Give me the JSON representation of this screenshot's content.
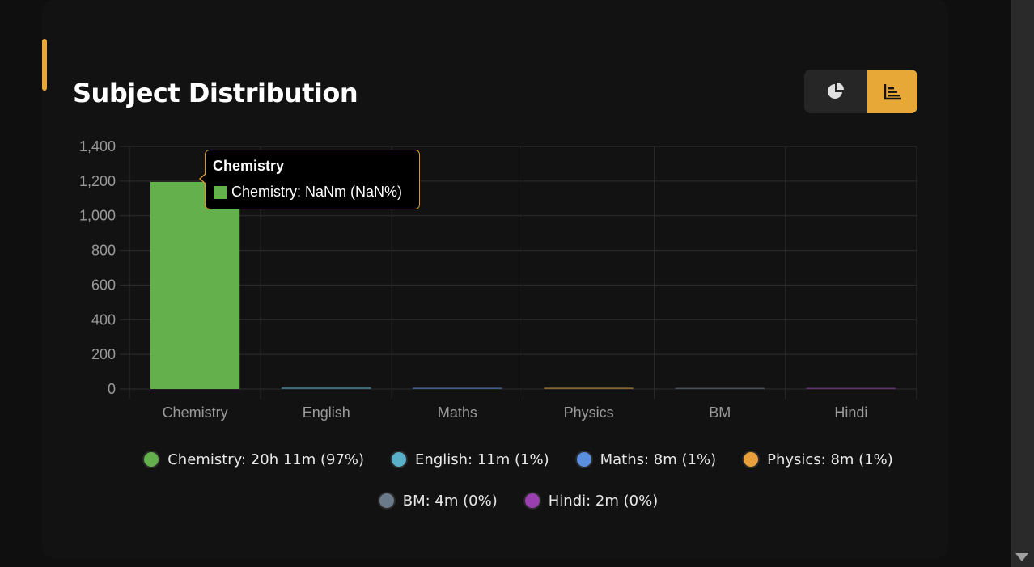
{
  "header": {
    "title": "Subject Distribution"
  },
  "toggle": {
    "options": [
      {
        "icon": "pie-chart-icon",
        "active": false
      },
      {
        "icon": "bar-chart-icon",
        "active": true
      }
    ]
  },
  "colors": {
    "accent": "#e8a838",
    "grid": "#2e2e2e",
    "tick": "#9a9a9a"
  },
  "chart_data": {
    "type": "bar",
    "title": "",
    "xlabel": "",
    "ylabel": "",
    "categories": [
      "Chemistry",
      "English",
      "Maths",
      "Physics",
      "BM",
      "Hindi"
    ],
    "values": [
      1195,
      11,
      8,
      8,
      4,
      2
    ],
    "bar_colors": [
      "#64b04c",
      "#5ab0c8",
      "#5b8fe0",
      "#e8a03c",
      "#6a7a8a",
      "#9a3fb0"
    ],
    "ylim": [
      0,
      1400
    ],
    "yticks": [
      0,
      200,
      400,
      600,
      800,
      1000,
      1200,
      1400
    ],
    "ytick_labels": [
      "0",
      "200",
      "400",
      "600",
      "800",
      "1,000",
      "1,200",
      "1,400"
    ],
    "grid": true,
    "legend_position": "bottom"
  },
  "legend": {
    "rows": [
      [
        {
          "label": "Chemistry: 20h 11m (97%)",
          "color": "#64b04c"
        },
        {
          "label": "English: 11m (1%)",
          "color": "#5ab0c8"
        },
        {
          "label": "Maths: 8m (1%)",
          "color": "#5b8fe0"
        },
        {
          "label": "Physics: 8m (1%)",
          "color": "#e8a03c"
        }
      ],
      [
        {
          "label": "BM: 4m (0%)",
          "color": "#6a7a8a"
        },
        {
          "label": "Hindi: 2m (0%)",
          "color": "#9a3fb0"
        }
      ]
    ]
  },
  "tooltip": {
    "title": "Chemistry",
    "body": "Chemistry: NaNm (NaN%)",
    "color": "#64b04c"
  }
}
